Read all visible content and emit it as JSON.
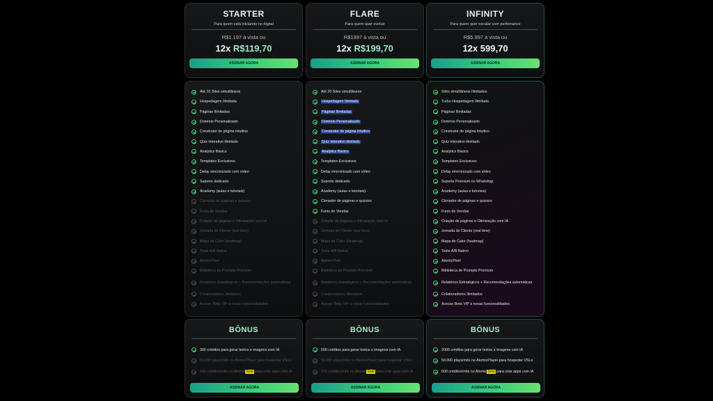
{
  "plans": [
    {
      "name": "STARTER",
      "subtitle": "Para quem está iniciando no digital",
      "price_line": "R$1.197 à vista ou",
      "installments": "12x",
      "installment_value": "R$119,70",
      "cta": "ASSINAR AGORA",
      "features": [
        {
          "text": "Até 10 Sites simultâneos",
          "on": true
        },
        {
          "text": "Hospedagem Ilimitada",
          "on": true
        },
        {
          "text": "Páginas Ilimitadas",
          "on": true
        },
        {
          "text": "Domínio Personalizado",
          "on": true
        },
        {
          "text": "Construtor de página intuitivo",
          "on": true
        },
        {
          "text": "Quiz interativo ilimitado",
          "on": true
        },
        {
          "text": "Analytics Básico",
          "on": true
        },
        {
          "text": "Templates Exclusivos",
          "on": true
        },
        {
          "text": "Delay sincronizado com vídeo",
          "on": true
        },
        {
          "text": "Suporte dedicado",
          "on": true
        },
        {
          "text": "Academy (aulas e tutoriais)",
          "on": true
        },
        {
          "text": "Clonador de páginas e quizzes",
          "on": false
        },
        {
          "text": "Funis de Vendas",
          "on": false
        },
        {
          "text": "Criação de páginas e Otimização com IA",
          "on": false
        },
        {
          "text": "Jornada do Cliente (real time)",
          "on": false
        },
        {
          "text": "Mapa de Calor (heatmap)",
          "on": false
        },
        {
          "text": "Teste A/B Nativo",
          "on": false
        },
        {
          "text": "AtomicPixel",
          "on": false
        },
        {
          "text": "Biblioteca de Prompts Premium",
          "on": false
        },
        {
          "text": "Relatórios Estratégicos + Recomendações automáticas",
          "on": false
        },
        {
          "text": "Colaboradores Ilimitados",
          "on": false
        },
        {
          "text": "Acesso Beta VIP à novas funcionalidades",
          "on": false
        }
      ],
      "bonus_title": "BÔNUS",
      "bonus": [
        {
          "text": "300 créditos para gerar textos e imagens com IA",
          "on": true
        },
        {
          "text": "50.000 plays/mês no AtomicPlayer para hospedar VSLs",
          "on": false
        },
        {
          "text": "500 créditos/mês no Atomic",
          "mark": "Seal",
          "after": " para criar apps com IA",
          "on": false
        }
      ],
      "bonus_cta": "ASSINAR AGORA"
    },
    {
      "name": "FLARE",
      "subtitle": "Para quem quer evoluir",
      "price_line": "R$1997 à vista ou",
      "installments": "12x",
      "installment_value": "R$199,70",
      "cta": "ASSINAR AGORA",
      "features": [
        {
          "text": "Até 20 Sites simultâneos",
          "on": true
        },
        {
          "text": "Hospedagem Ilimitada",
          "on": true,
          "hl": true
        },
        {
          "text": "Páginas Ilimitadas",
          "on": true,
          "hl": true
        },
        {
          "text": "Domínio Personalizado",
          "on": true,
          "hl": true
        },
        {
          "text": "Construtor de página intuitivo",
          "on": true,
          "hl": true
        },
        {
          "text": "Quiz interativo ilimitado",
          "on": true,
          "hl": true
        },
        {
          "text": "Analytics Básico",
          "on": true,
          "hl": true
        },
        {
          "text": "Templates Exclusivos",
          "on": true
        },
        {
          "text": "Delay sincronizado com vídeo",
          "on": true
        },
        {
          "text": "Suporte dedicado",
          "on": true
        },
        {
          "text": "Academy (aulas e tutoriais)",
          "on": true
        },
        {
          "text": "Clonador de páginas e quizzes",
          "on": true
        },
        {
          "text": "Funis de Vendas",
          "on": true
        },
        {
          "text": "Criação de páginas e Otimização com IA",
          "on": false
        },
        {
          "text": "Jornada do Cliente (real time)",
          "on": false
        },
        {
          "text": "Mapa de Calor (heatmap)",
          "on": false
        },
        {
          "text": "Teste A/B Nativo",
          "on": false
        },
        {
          "text": "AtomicPixel",
          "on": false
        },
        {
          "text": "Biblioteca de Prompts Premium",
          "on": false
        },
        {
          "text": "Relatórios Estratégicos + Recomendações automáticas",
          "on": false
        },
        {
          "text": "Colaboradores Ilimitados",
          "on": false
        },
        {
          "text": "Acesso Beta VIP à novas funcionalidades",
          "on": false
        }
      ],
      "bonus_title": "BÔNUS",
      "bonus": [
        {
          "text": "500 créditos para gerar textos e imagens com IA",
          "on": true
        },
        {
          "text": "50.000 plays/mês no AtomicPlayer para hospedar VSLs",
          "on": false
        },
        {
          "text": "500 créditos/mês no Atomic",
          "mark": "Seal",
          "after": " para criar apps com IA",
          "on": false
        }
      ],
      "bonus_cta": "ASSINAR AGORA"
    },
    {
      "name": "INFINITY",
      "subtitle": "Para quem quer escalar com perfomance",
      "price_line": "R$5.997 à vista ou",
      "installments": "12x",
      "installment_value": "599,70",
      "cta": "ASSINAR AGORA",
      "features": [
        {
          "text": "Sites simultâneos Ilimitados",
          "on": true
        },
        {
          "text": "Turbo Hospedagem Ilimitada",
          "on": true
        },
        {
          "text": "Páginas Ilimitadas",
          "on": true
        },
        {
          "text": "Domínio Personalizado",
          "on": true
        },
        {
          "text": "Construtor de página intuitivo",
          "on": true
        },
        {
          "text": "Quiz interativo ilimitado",
          "on": true
        },
        {
          "text": "Analytics Básico",
          "on": true
        },
        {
          "text": "Templates Exclusivos",
          "on": true
        },
        {
          "text": "Delay sincronizado com vídeo",
          "on": true
        },
        {
          "text": "Suporte Premium no WhatsApp",
          "on": true
        },
        {
          "text": "Academy (aulas e tutoriais)",
          "on": true
        },
        {
          "text": "Clonador de páginas e quizzes",
          "on": true
        },
        {
          "text": "Funis de Vendas",
          "on": true
        },
        {
          "text": "Criação de páginas e Otimização com IA",
          "on": true
        },
        {
          "text": "Jornada do Cliente (real time)",
          "on": true
        },
        {
          "text": "Mapa de Calor (heatmap)",
          "on": true
        },
        {
          "text": "Teste A/B Nativo",
          "on": true
        },
        {
          "text": "AtomicPixel",
          "on": true
        },
        {
          "text": "Biblioteca de Prompts Premium",
          "on": true
        },
        {
          "text": "Relatórios Estratégicos + Recomendações automáticas",
          "on": true
        },
        {
          "text": "Colaboradores Ilimitados",
          "on": true
        },
        {
          "text": "Acesso Beta VIP à novas funcionalidades",
          "on": true
        }
      ],
      "bonus_title": "BÔNUS",
      "bonus": [
        {
          "text": "2000 créditos para gerar textos e imagens com IA",
          "on": true
        },
        {
          "text": "50.000 plays/mês no AtomicPlayer para hospedar VSLs",
          "on": true
        },
        {
          "text": "500 créditos/mês no Atomic",
          "mark": "Seal",
          "after": " para criar apps com IA",
          "on": true
        }
      ],
      "bonus_cta": "ASSINAR AGORA"
    }
  ],
  "colors": {
    "accent_green": "#45d07a",
    "button_gradient_start": "#1a9f8a",
    "button_gradient_end": "#6be070",
    "selection_highlight": "#1f3e8c",
    "marker_highlight": "#e7e000"
  }
}
